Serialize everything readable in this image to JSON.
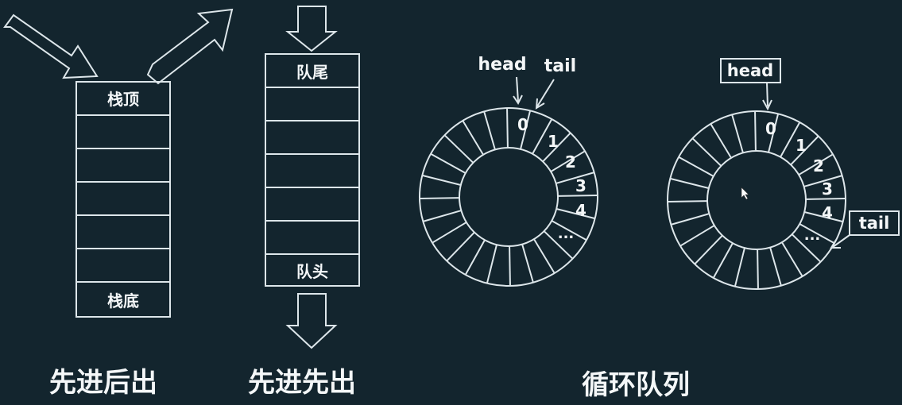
{
  "stack": {
    "top_label": "栈顶",
    "bottom_label": "栈底",
    "caption": "先进后出"
  },
  "queue": {
    "tail_label": "队尾",
    "head_label": "队头",
    "caption": "先进先出"
  },
  "circular": {
    "caption": "循环队列",
    "ring1": {
      "head_label": "head",
      "tail_label": "tail",
      "indices": [
        "0",
        "1",
        "2",
        "3",
        "4",
        "..."
      ]
    },
    "ring2": {
      "head_label": "head",
      "tail_label": "tail",
      "indices": [
        "0",
        "1",
        "2",
        "3",
        "4",
        "..."
      ]
    }
  },
  "colors": {
    "background": "#13252e",
    "line": "#dde6ea",
    "text": "#f4f7f8"
  }
}
